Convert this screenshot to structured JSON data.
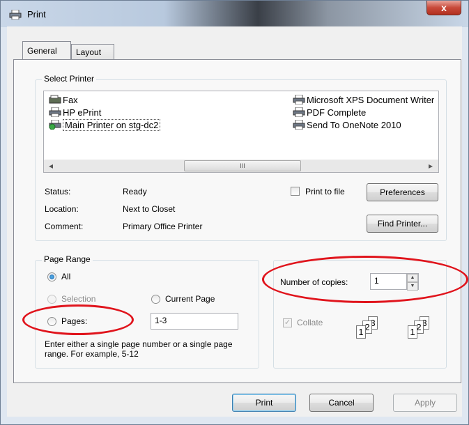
{
  "window": {
    "title": "Print",
    "close_label": "x"
  },
  "tabs": [
    {
      "label": "General"
    },
    {
      "label": "Layout"
    }
  ],
  "select_printer": {
    "group_label": "Select Printer",
    "printers_left": [
      {
        "name": "Fax",
        "icon": "fax-icon"
      },
      {
        "name": "HP ePrint",
        "icon": "printer-icon"
      },
      {
        "name": "Main Printer on stg-dc2",
        "icon": "network-printer-icon",
        "selected": true
      }
    ],
    "printers_right": [
      {
        "name": "Microsoft XPS Document Writer",
        "icon": "printer-icon"
      },
      {
        "name": "PDF Complete",
        "icon": "printer-icon"
      },
      {
        "name": "Send To OneNote 2010",
        "icon": "printer-icon"
      }
    ],
    "scroll_left": "◂",
    "scroll_right": "▸",
    "scroll_grip": "III",
    "status_label": "Status:",
    "status_value": "Ready",
    "location_label": "Location:",
    "location_value": "Next to Closet",
    "comment_label": "Comment:",
    "comment_value": "Primary Office Printer",
    "print_to_file_label": "Print to file",
    "preferences_label": "Preferences",
    "find_printer_label": "Find Printer..."
  },
  "page_range": {
    "group_label": "Page Range",
    "all_label": "All",
    "selection_label": "Selection",
    "current_page_label": "Current Page",
    "pages_label": "Pages:",
    "pages_value": "1-3",
    "hint": "Enter either a single page number or a single page range.  For example, 5-12",
    "selected_option": "All"
  },
  "copies": {
    "number_label": "Number of copies:",
    "number_value": "1",
    "collate_label": "Collate",
    "collate_checked": true,
    "collate_pages": [
      "1",
      "2",
      "3"
    ]
  },
  "buttons": {
    "print": "Print",
    "cancel": "Cancel",
    "apply": "Apply"
  },
  "colors": {
    "annotation_red": "#e0141c",
    "accent_blue": "#3c7fb1"
  }
}
